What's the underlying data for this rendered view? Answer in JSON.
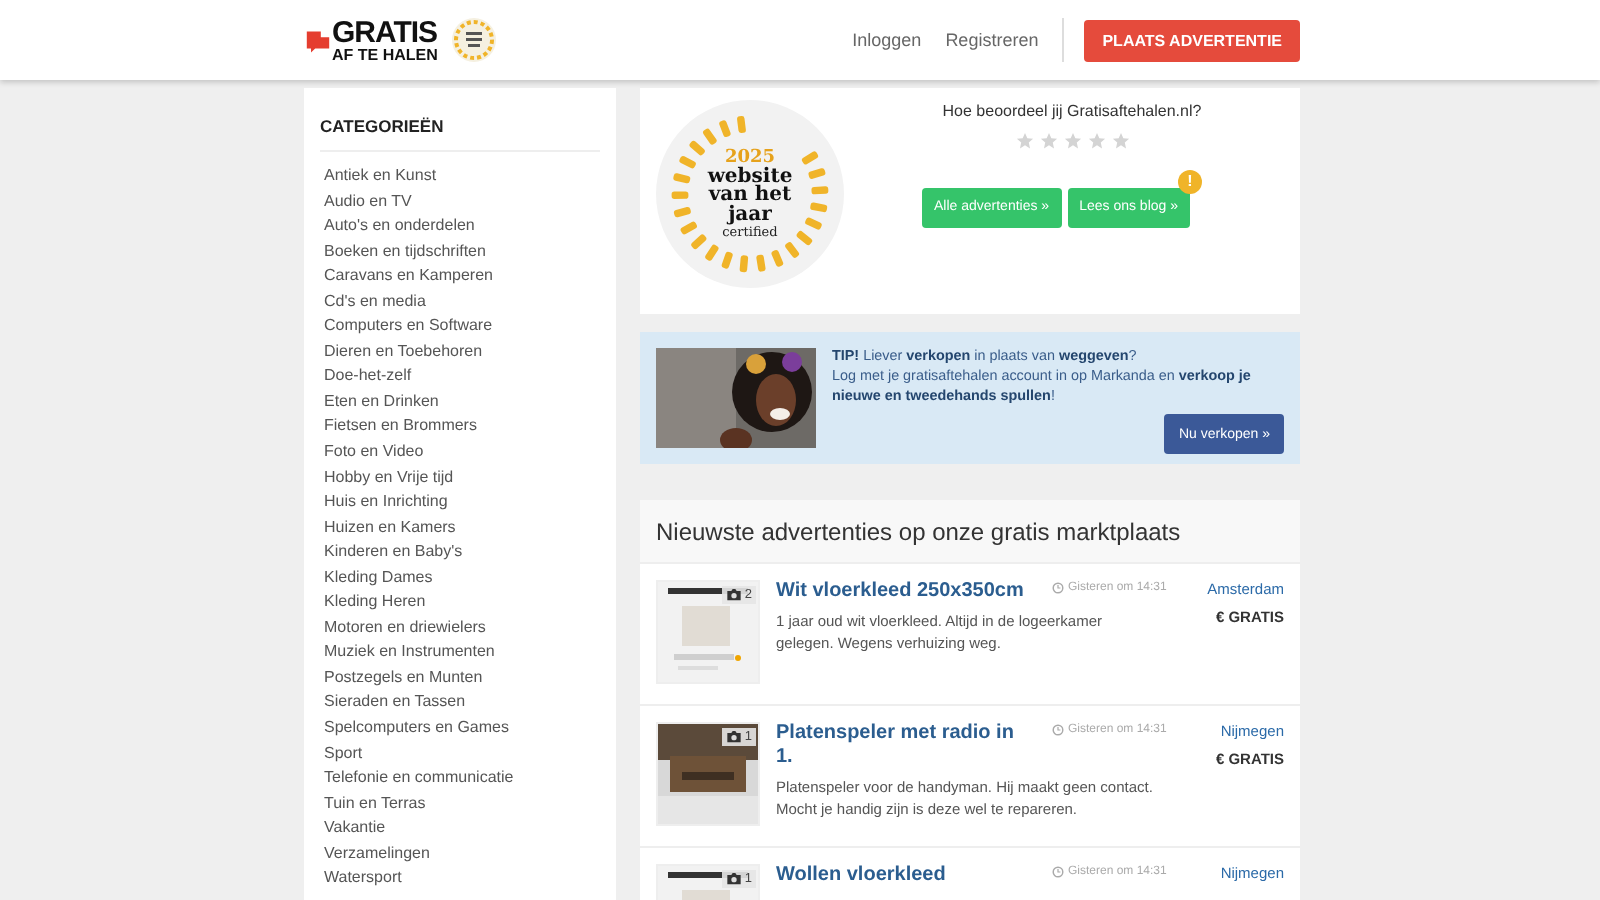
{
  "header": {
    "logo": {
      "line1": "GRATIS",
      "line2": "AF TE HALEN"
    },
    "nav": [
      "Inloggen",
      "Registreren"
    ],
    "cta": "PLAATS ADVERTENTIE"
  },
  "sidebar": {
    "title": "CATEGORIEËN",
    "items": [
      "Antiek en Kunst",
      "Audio en TV",
      "Auto's en onderdelen",
      "Boeken en tijdschriften",
      "Caravans en Kamperen",
      "Cd's en media",
      "Computers en Software",
      "Dieren en Toebehoren",
      "Doe-het-zelf",
      "Eten en Drinken",
      "Fietsen en Brommers",
      "Foto en Video",
      "Hobby en Vrije tijd",
      "Huis en Inrichting",
      "Huizen en Kamers",
      "Kinderen en Baby's",
      "Kleding Dames",
      "Kleding Heren",
      "Motoren en driewielers",
      "Muziek en Instrumenten",
      "Postzegels en Munten",
      "Sieraden en Tassen",
      "Spelcomputers en Games",
      "Sport",
      "Telefonie en communicatie",
      "Tuin en Terras",
      "Vakantie",
      "Verzamelingen",
      "Watersport"
    ]
  },
  "award": {
    "year": "2025",
    "title": "website van het jaar",
    "subtitle": "certified"
  },
  "rating": {
    "question": "Hoe beoordeel jij Gratisaftehalen.nl?",
    "stars": 0
  },
  "buttons": [
    {
      "label": "Alle advertenties »",
      "alert": false
    },
    {
      "label": "Lees ons blog »",
      "alert": true,
      "alert_text": "!"
    }
  ],
  "tip": {
    "line1": "**TIP!** Liever **verkopen** in plaats van **weggeven**?",
    "line2": "Log met je gratisaftehalen account in op Markanda en **verkoop je nieuwe en tweedehands spullen**!",
    "button": "Nu verkopen »"
  },
  "listings": {
    "heading": "Nieuwste advertenties op onze gratis marktplaats",
    "items": [
      {
        "photos": "2",
        "title": "Wit vloerkleed 250x350cm",
        "time": "Gisteren om 14:31",
        "description": "1 jaar oud wit vloerkleed. Altijd in de logeerkamer gelegen. Wegens verhuizing weg.",
        "city": "Amsterdam",
        "price": "€ GRATIS"
      },
      {
        "photos": "1",
        "title": "Platenspeler met radio in 1.",
        "time": "Gisteren om 14:31",
        "description": "Platenspeler voor de handyman. Hij maakt geen contact. Mocht je handig zijn is deze wel te repareren.",
        "city": "Nijmegen",
        "price": "€ GRATIS"
      },
      {
        "photos": "1",
        "title": "Wollen vloerkleed",
        "time": "Gisteren om 14:31",
        "city": "Nijmegen"
      }
    ]
  }
}
